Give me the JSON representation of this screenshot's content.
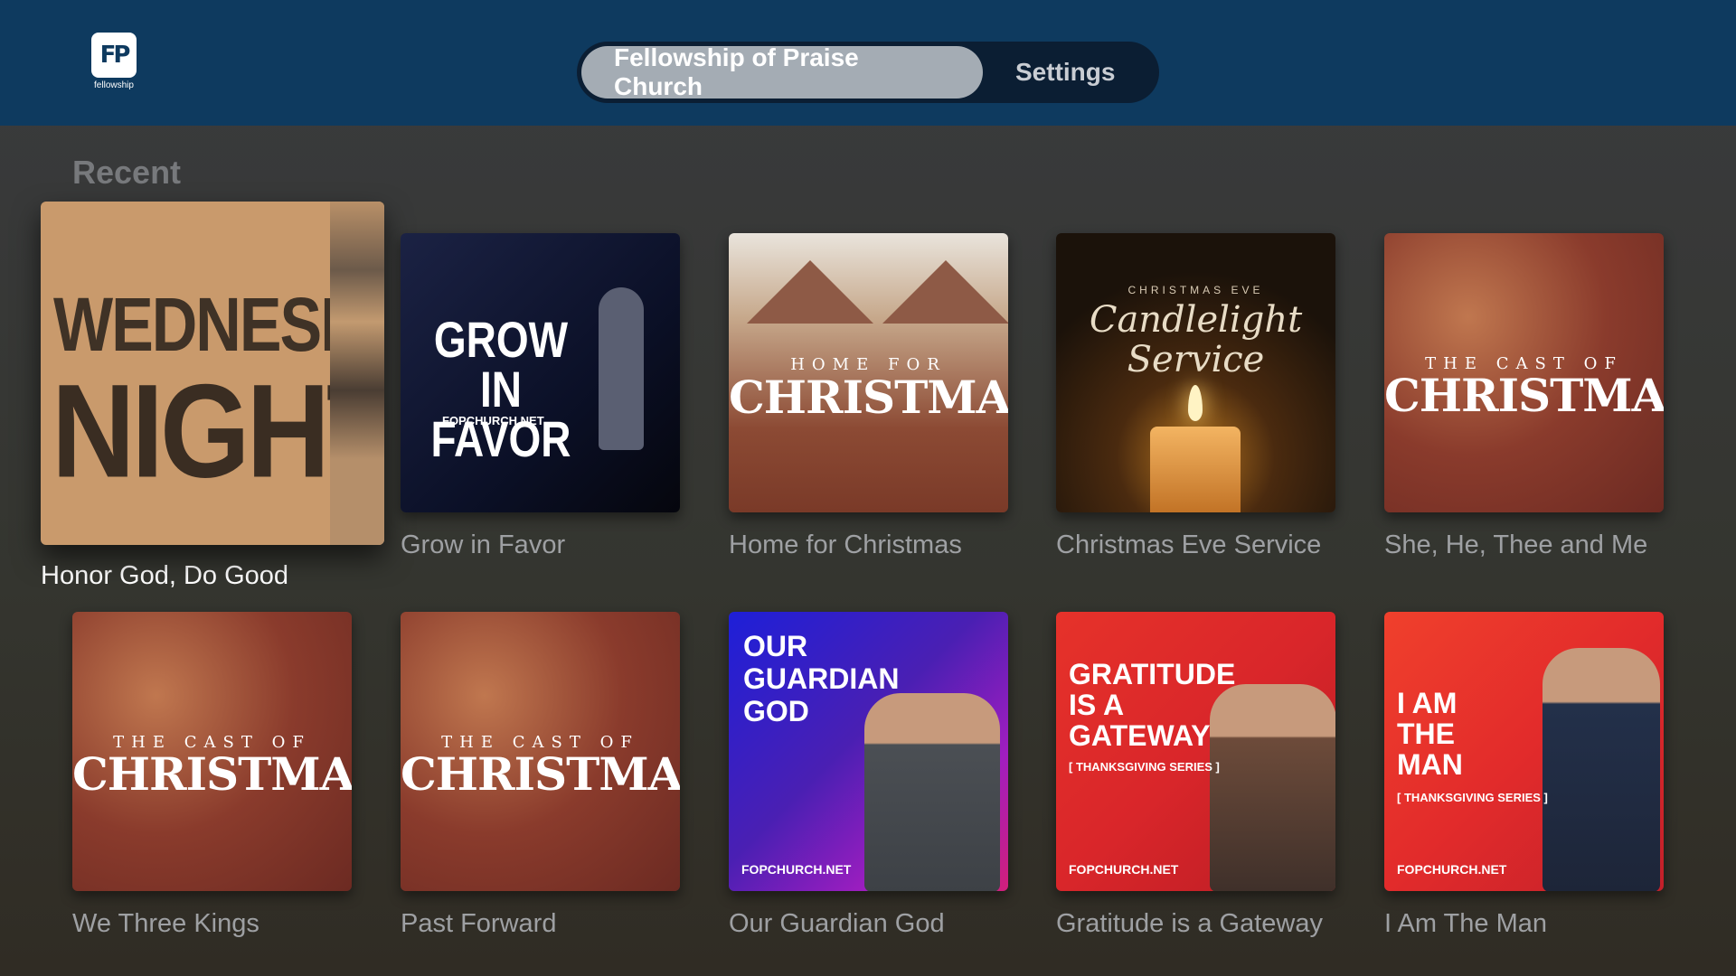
{
  "app": {
    "logo_text": "fellowship",
    "logo_mark": "FP"
  },
  "header": {
    "tabs": [
      {
        "label": "Fellowship of Praise Church",
        "active": true
      },
      {
        "label": "Settings",
        "active": false
      }
    ]
  },
  "section": {
    "title": "Recent"
  },
  "tiles": [
    {
      "caption": "Honor God, Do Good",
      "art": {
        "line1": "WEDNESDAY",
        "line2": "NIGHTS"
      },
      "focused": true
    },
    {
      "caption": "Grow in Favor",
      "art": {
        "title": "GROW IN FAVOR",
        "url": "FOPCHURCH.NET"
      }
    },
    {
      "caption": "Home for Christmas",
      "art": {
        "sub": "HOME FOR",
        "main": "CHRISTMAS"
      }
    },
    {
      "caption": "Christmas Eve Service",
      "art": {
        "sub": "CHRISTMAS EVE",
        "script": "Candlelight Service"
      }
    },
    {
      "caption": "She, He, Thee and Me",
      "art": {
        "sub": "THE CAST OF",
        "main": "CHRISTMAS"
      }
    },
    {
      "caption": "We Three Kings",
      "art": {
        "sub": "THE CAST OF",
        "main": "CHRISTMAS"
      }
    },
    {
      "caption": "Past Forward",
      "art": {
        "sub": "THE CAST OF",
        "main": "CHRISTMAS"
      }
    },
    {
      "caption": "Our Guardian God",
      "art": {
        "title": "OUR GUARDIAN GOD",
        "url": "FOPCHURCH.NET"
      }
    },
    {
      "caption": "Gratitude is a Gateway",
      "art": {
        "title": "GRATITUDE IS A GATEWAY",
        "series": "[ THANKSGIVING SERIES ]",
        "url": "FOPCHURCH.NET"
      }
    },
    {
      "caption": "I Am The Man",
      "art": {
        "title": "I AM THE MAN",
        "series": "[ THANKSGIVING SERIES ]",
        "url": "FOPCHURCH.NET"
      }
    }
  ],
  "colors": {
    "header_bg": "#0e3a5f",
    "active_tab_bg": "#a4acb4",
    "caption": "#9ea0a3",
    "focused_caption": "#ffffff"
  }
}
